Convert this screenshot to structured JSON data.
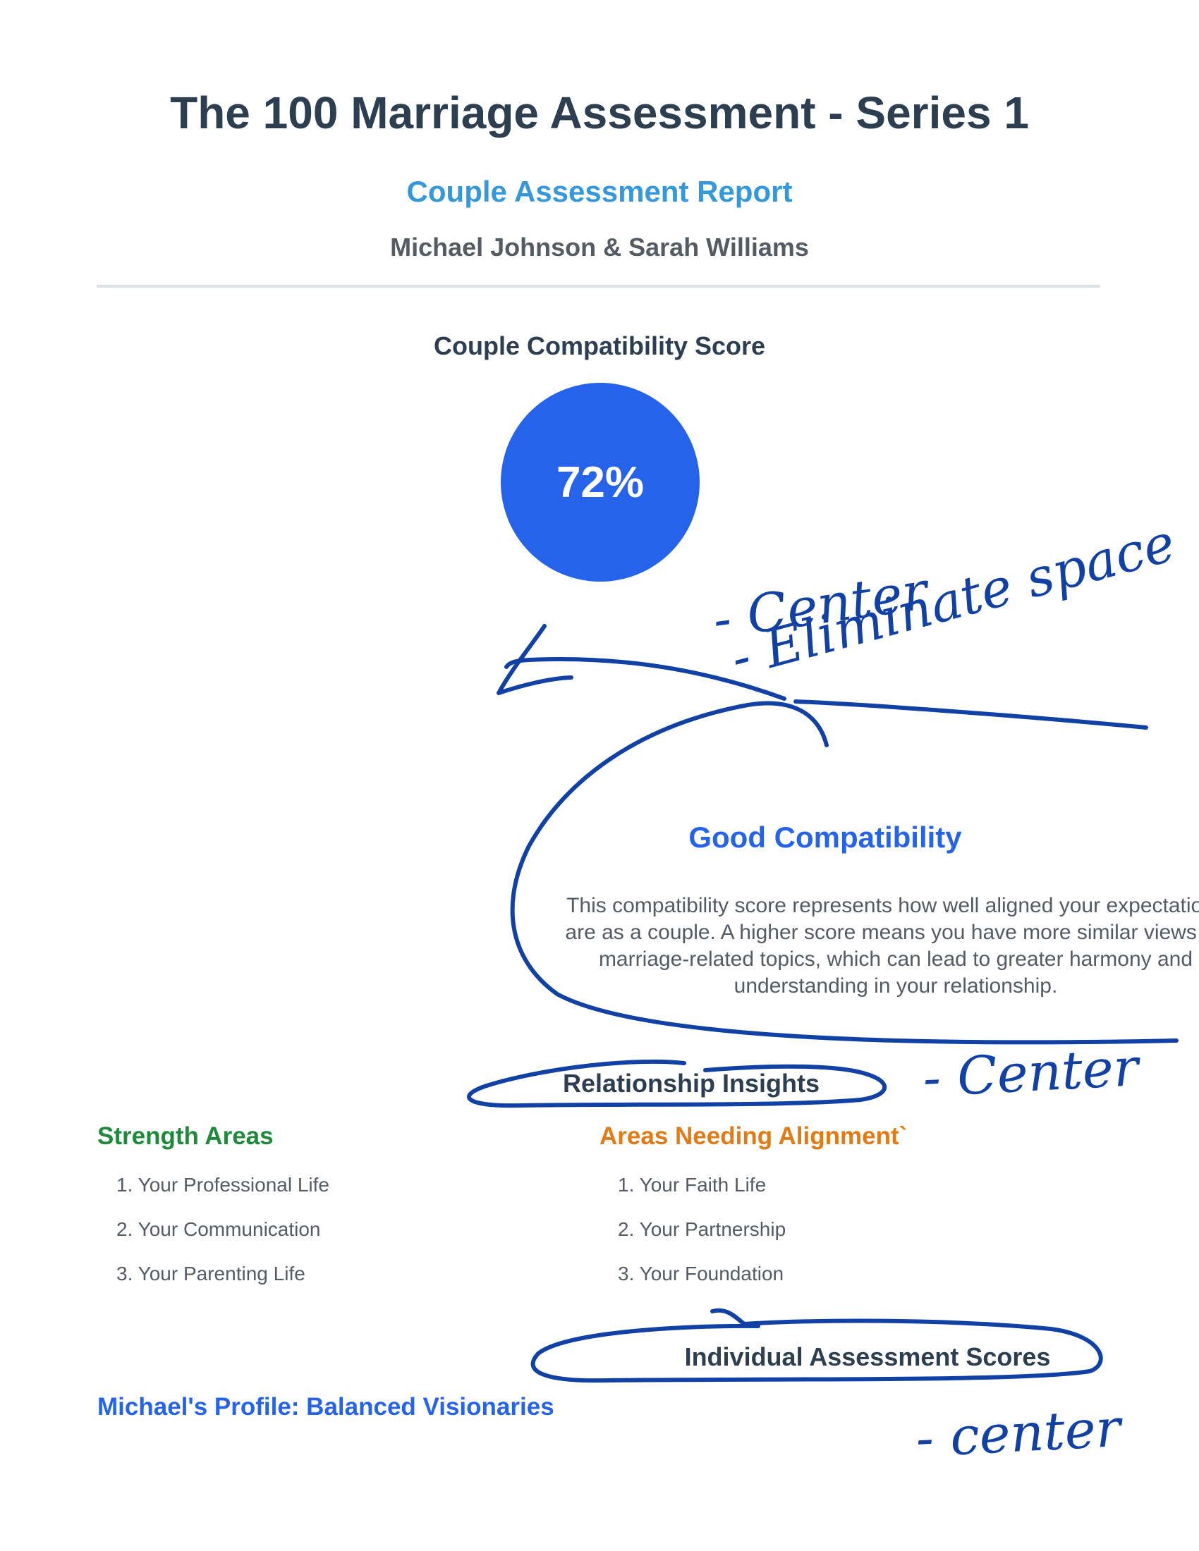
{
  "header": {
    "title": "The 100 Marriage Assessment - Series 1",
    "subtitle": "Couple Assessment Report",
    "couple_names": "Michael Johnson & Sarah Williams"
  },
  "compatibility": {
    "heading": "Couple Compatibility Score",
    "score_text": "72%",
    "score_percent": 72,
    "label": "Good Compatibility",
    "description": "This compatibility score represents how well aligned your expectations are as a couple. A higher score means you have more similar views on marriage-related topics, which can lead to greater harmony and understanding in your relationship."
  },
  "insights": {
    "heading": "Relationship Insights",
    "strength": {
      "heading": "Strength Areas",
      "items": [
        "Your Professional Life",
        "Your Communication",
        "Your Parenting Life"
      ]
    },
    "alignment": {
      "heading": "Areas Needing Alignment`",
      "items": [
        "Your Faith Life",
        "Your Partnership",
        "Your Foundation"
      ]
    }
  },
  "individual": {
    "heading": "Individual Assessment Scores",
    "profile_heading": "Michael's Profile: Balanced Visionaries"
  },
  "annotations": {
    "note_center_1": "- Center",
    "note_eliminate": "- Eliminate space",
    "note_center_2": "- Center",
    "note_center_3": "- center"
  },
  "colors": {
    "title": "#2c3e50",
    "subtitle": "#3498db",
    "score_circle": "#2563eb",
    "strength": "#1e8a3a",
    "alignment": "#e07b15",
    "ink": "#1241a6"
  }
}
